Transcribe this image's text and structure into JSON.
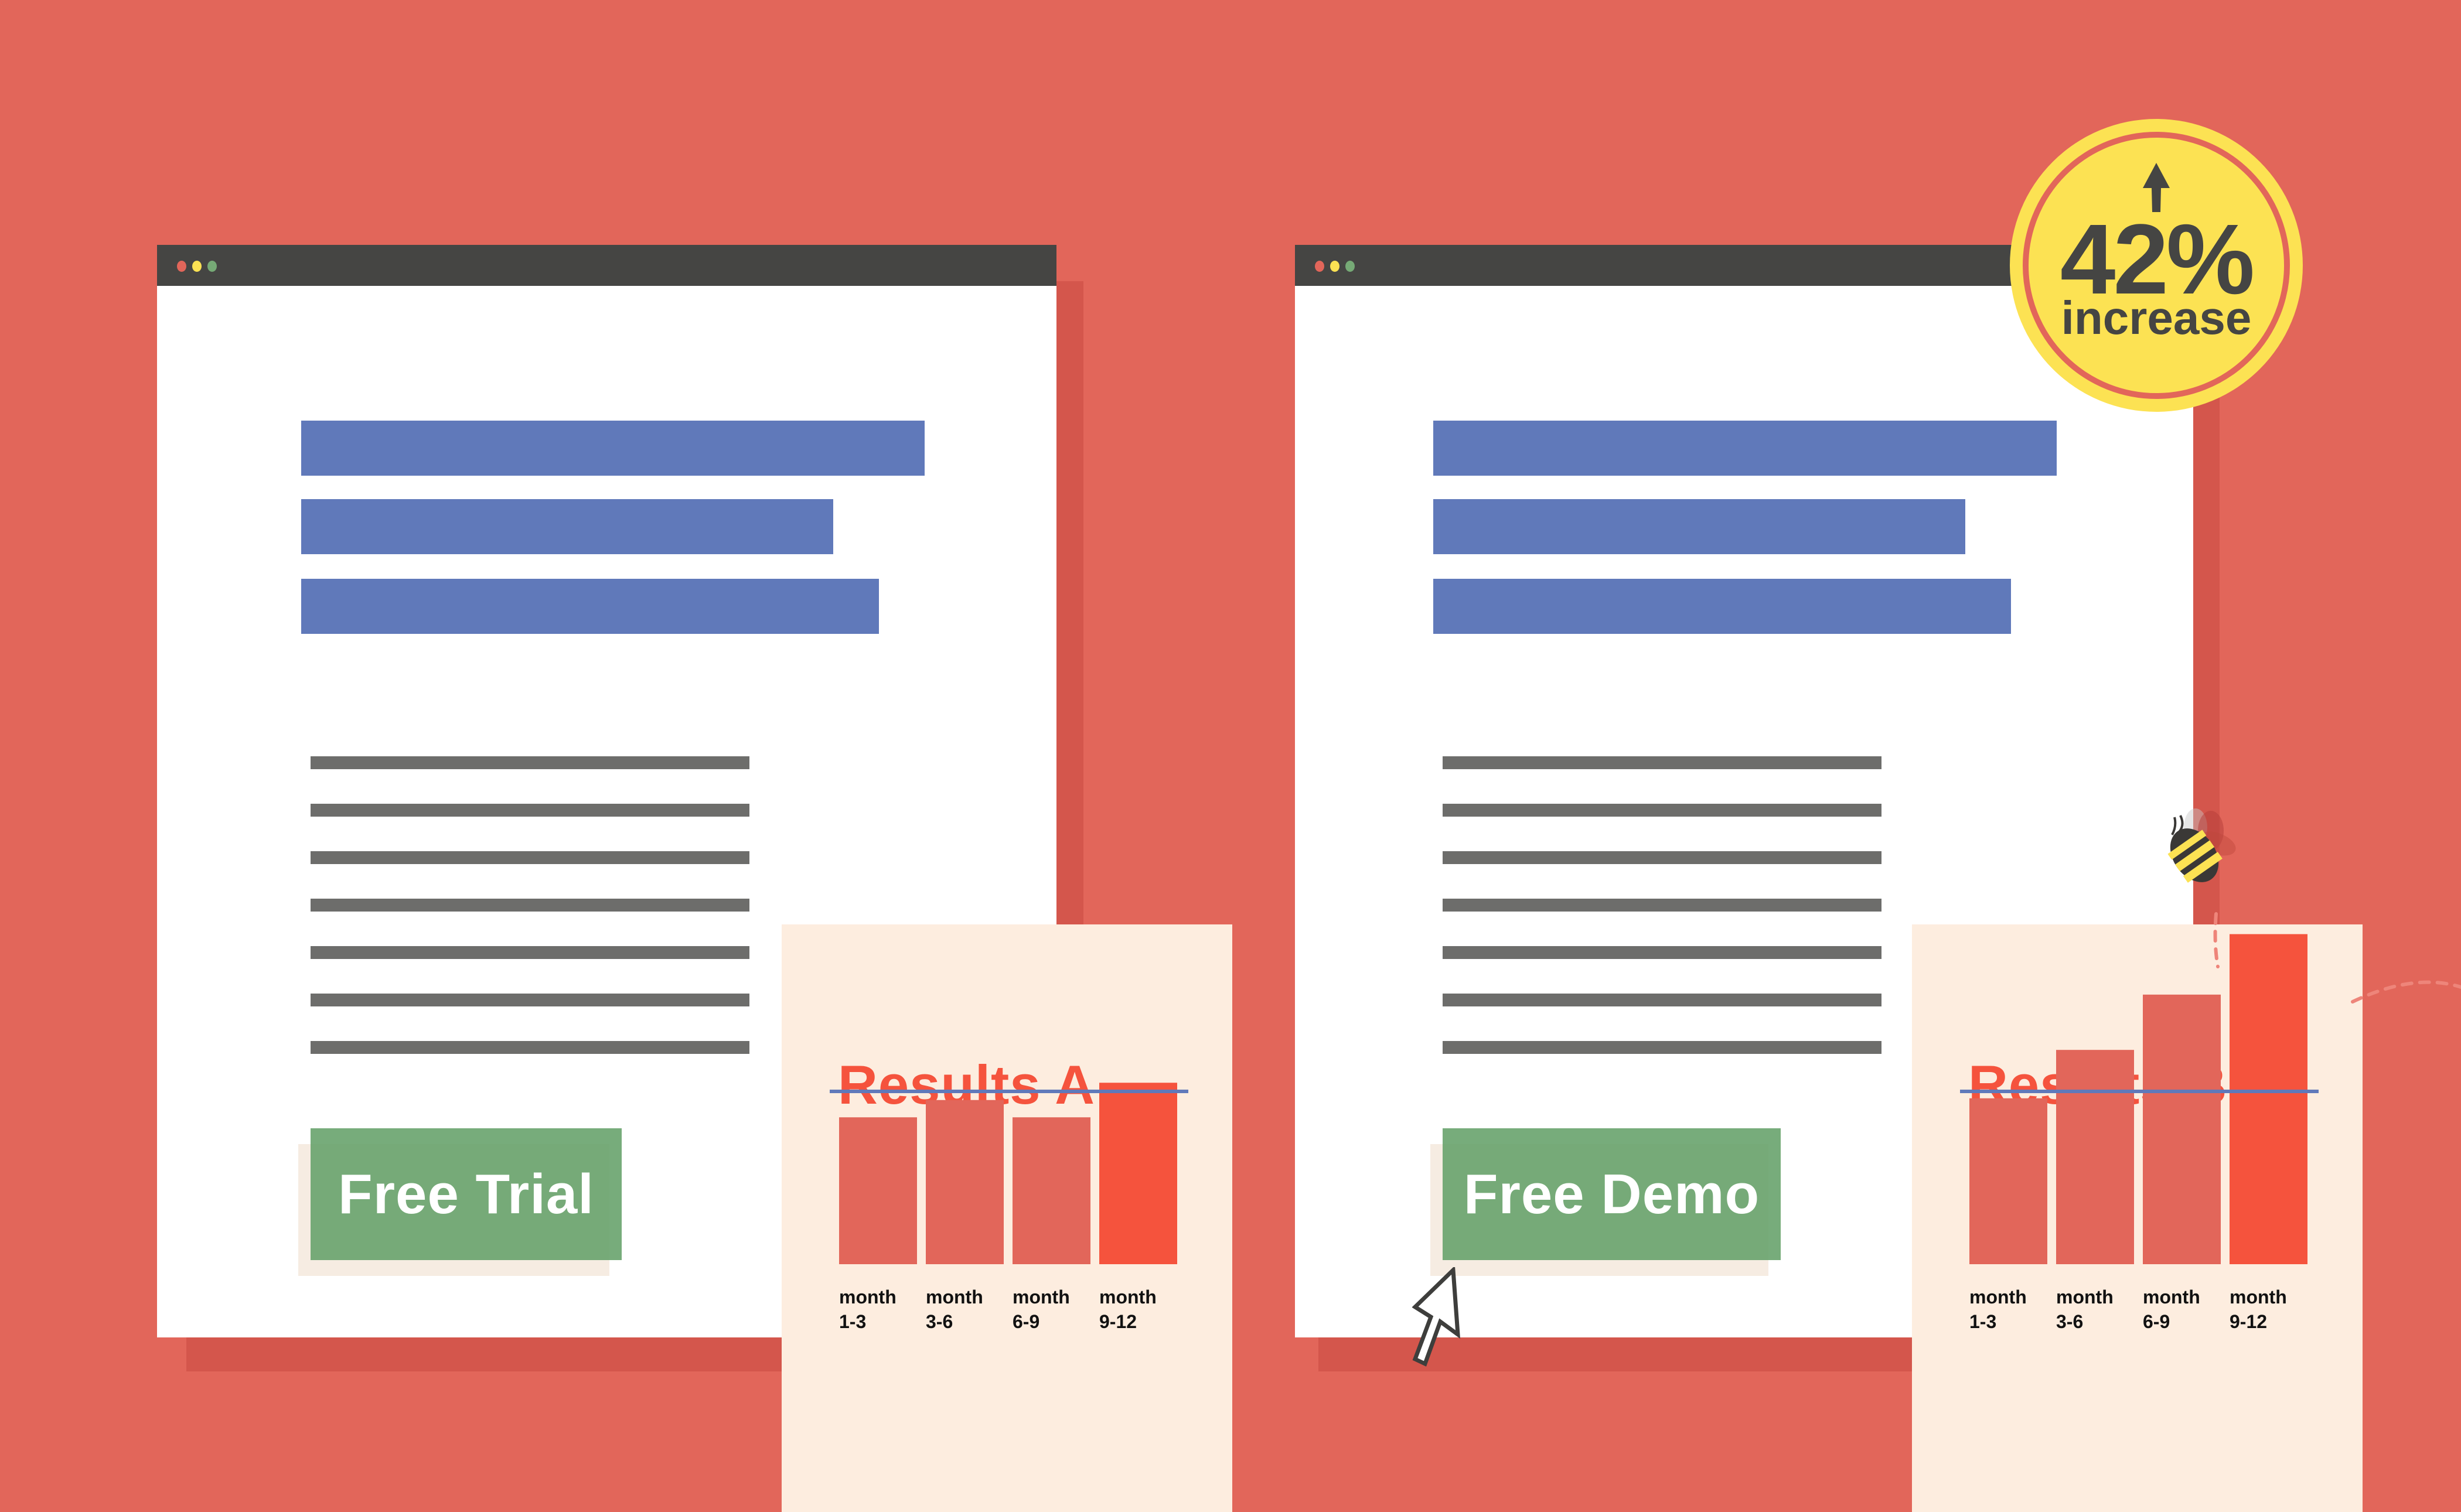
{
  "colors": {
    "background": "#E2665A",
    "headline_bar": "#6079BA",
    "text_line": "#6D6D6B",
    "cta_green": "#64A069",
    "titlebar": "#454543",
    "card_bg": "#FDEDDF",
    "results_title": "#F5533D",
    "badge_yellow": "#FCE253",
    "traffic_red": "#E2665A",
    "traffic_yellow": "#FCE253",
    "traffic_green": "#76AA76"
  },
  "variant_a": {
    "window_controls": [
      "close",
      "minimize",
      "maximize"
    ],
    "cta_label": "Free Trial"
  },
  "variant_b": {
    "window_controls": [
      "close",
      "minimize",
      "maximize"
    ],
    "cta_label": "Free Demo"
  },
  "badge": {
    "icon": "arrow-up-icon",
    "value": "42%",
    "label": "increase"
  },
  "chart_data": [
    {
      "type": "bar",
      "title": "Results A",
      "categories": [
        "month\n1-3",
        "month\n3-6",
        "month\n6-9",
        "month\n9-12"
      ],
      "values": [
        85,
        95,
        85,
        105
      ],
      "reference_line": 100,
      "highlight_index": 3,
      "ylim": [
        0,
        200
      ],
      "xlabel": "",
      "ylabel": "",
      "grid": false
    },
    {
      "type": "bar",
      "title": "Results B",
      "categories": [
        "month\n1-3",
        "month\n3-6",
        "month\n6-9",
        "month\n9-12"
      ],
      "values": [
        96,
        124,
        156,
        191
      ],
      "reference_line": 100,
      "highlight_index": 3,
      "ylim": [
        0,
        200
      ],
      "xlabel": "",
      "ylabel": "",
      "grid": false
    }
  ]
}
